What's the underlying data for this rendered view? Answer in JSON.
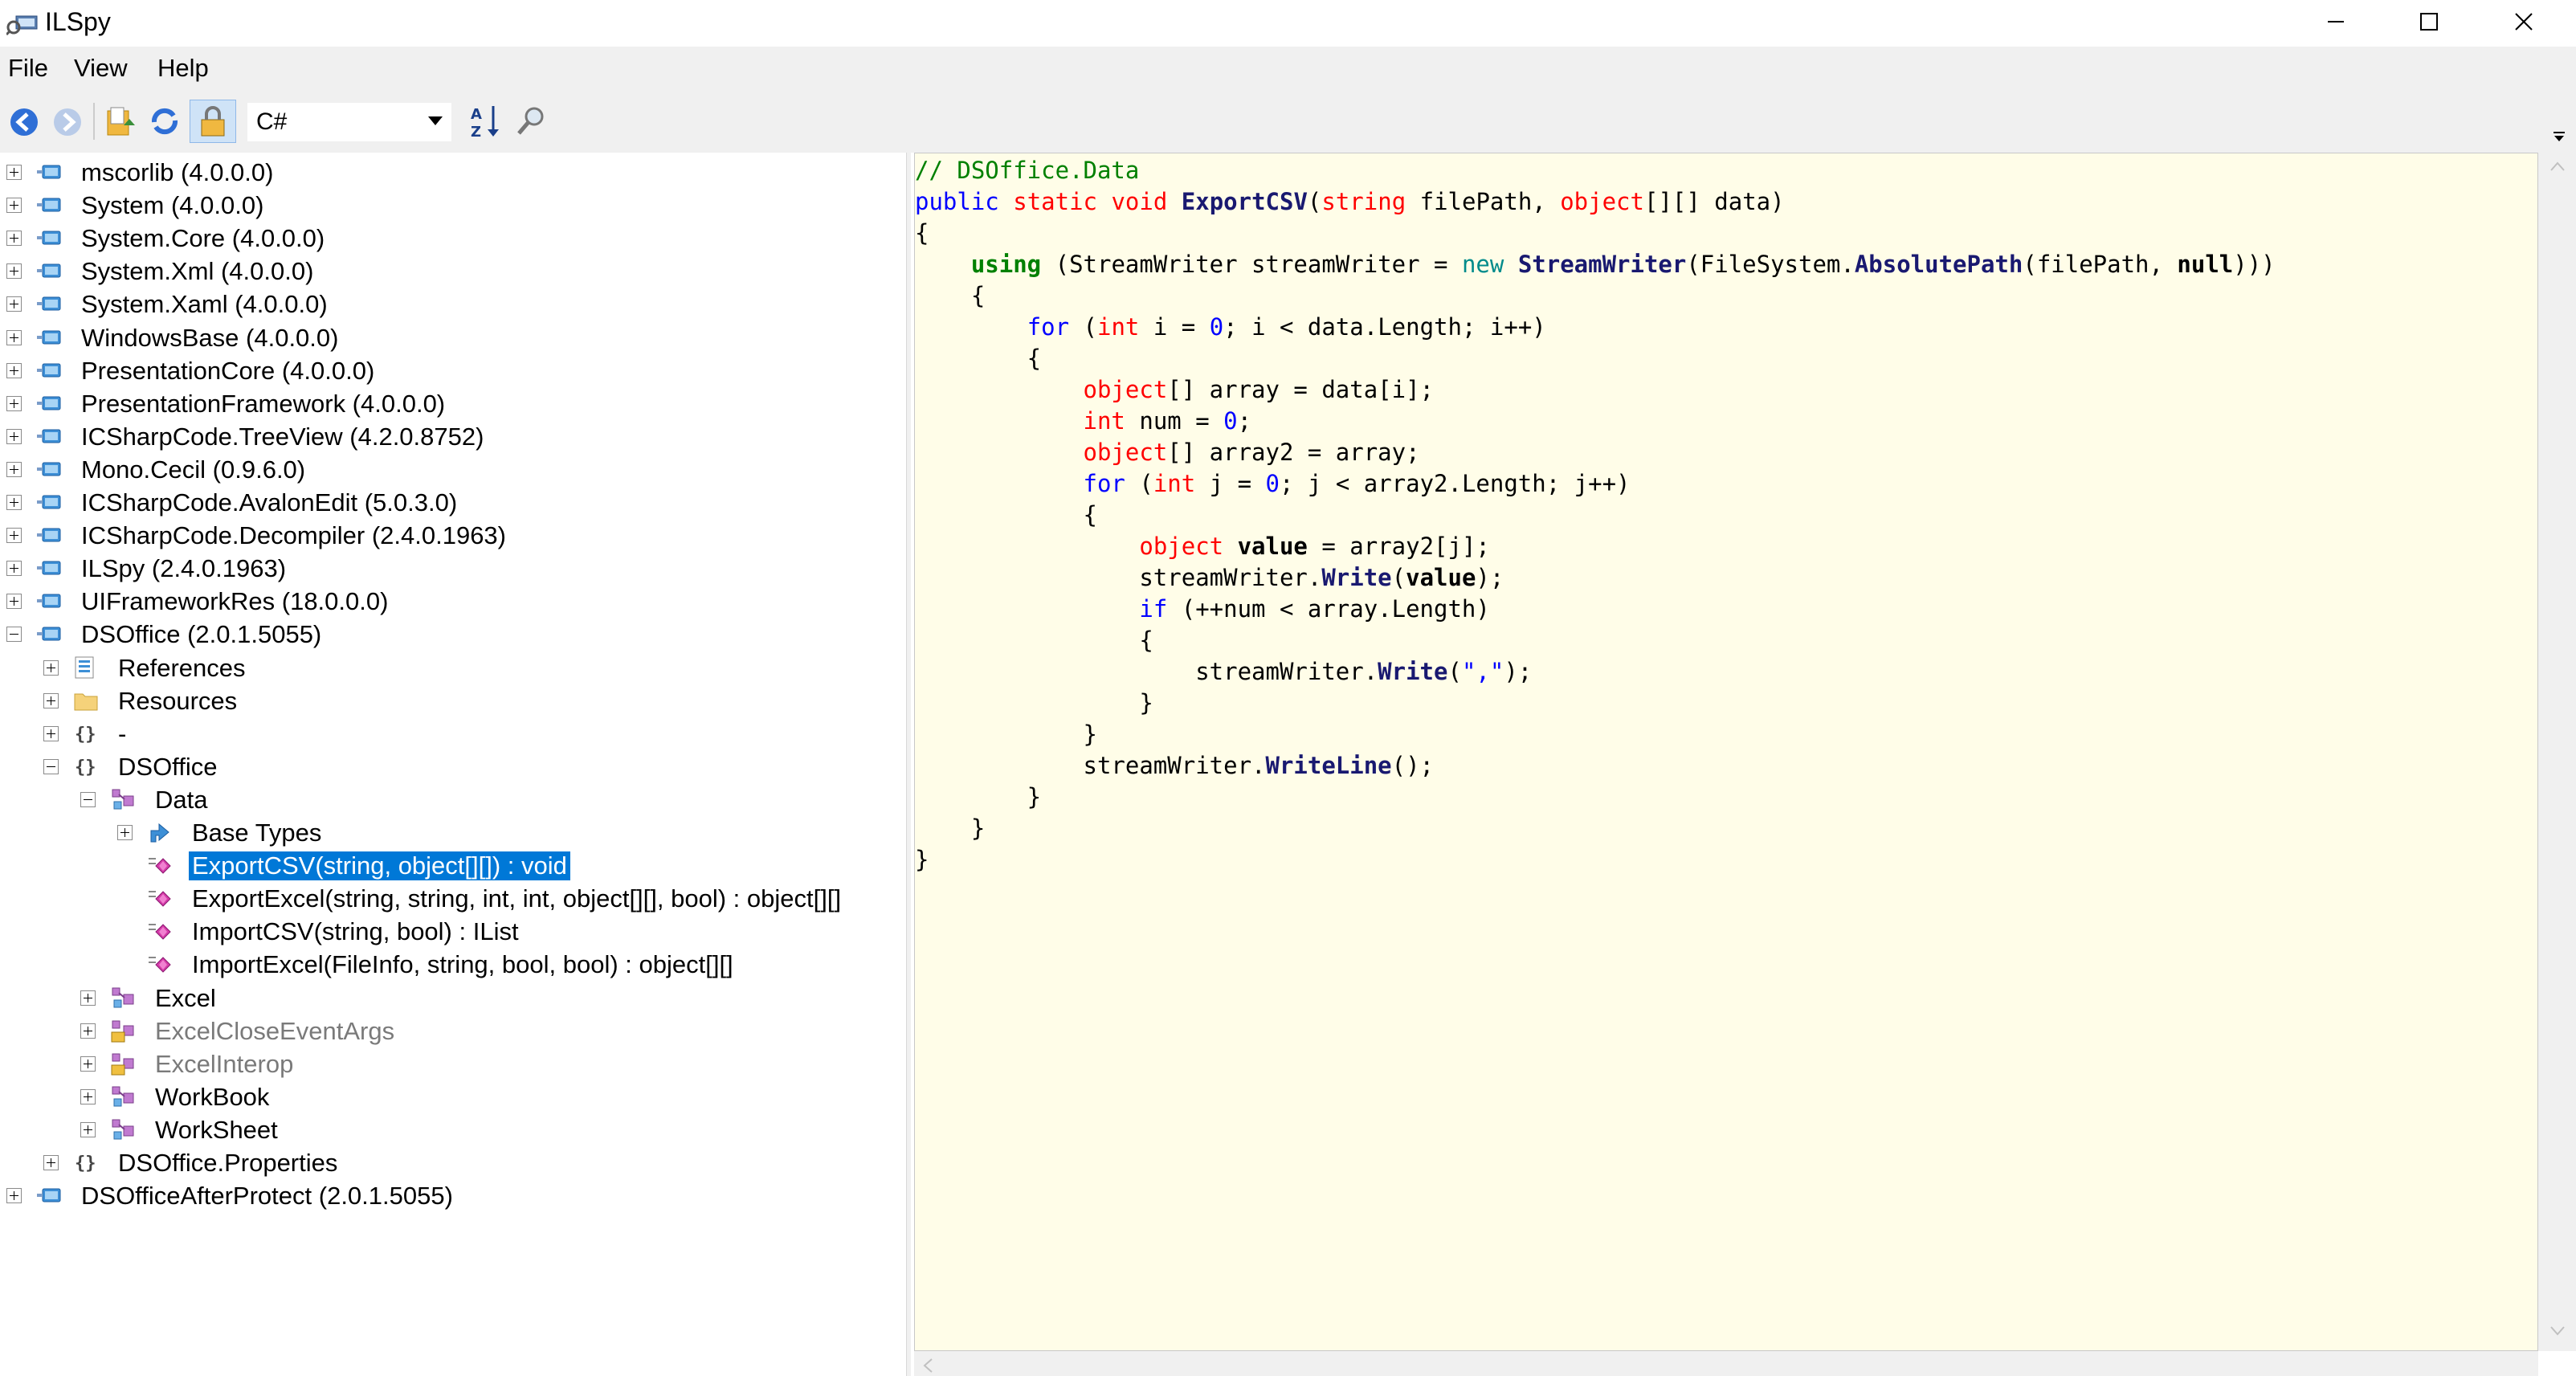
{
  "window": {
    "title": "ILSpy",
    "controls": {
      "minimize": "—",
      "maximize": "☐",
      "close": "✕"
    }
  },
  "menu": {
    "items": [
      "File",
      "View",
      "Help"
    ]
  },
  "toolbar": {
    "language": "C#",
    "icons": [
      "back-icon",
      "forward-icon",
      "open-icon",
      "reload-icon",
      "show-private-icon",
      "sort-icon",
      "search-icon"
    ]
  },
  "tree": {
    "nodes": [
      {
        "label": "mscorlib (4.0.0.0)",
        "level": 0,
        "icon": "assembly-icon",
        "expander": "plus"
      },
      {
        "label": "System (4.0.0.0)",
        "level": 0,
        "icon": "assembly-icon",
        "expander": "plus"
      },
      {
        "label": "System.Core (4.0.0.0)",
        "level": 0,
        "icon": "assembly-icon",
        "expander": "plus"
      },
      {
        "label": "System.Xml (4.0.0.0)",
        "level": 0,
        "icon": "assembly-icon",
        "expander": "plus"
      },
      {
        "label": "System.Xaml (4.0.0.0)",
        "level": 0,
        "icon": "assembly-icon",
        "expander": "plus"
      },
      {
        "label": "WindowsBase (4.0.0.0)",
        "level": 0,
        "icon": "assembly-icon",
        "expander": "plus"
      },
      {
        "label": "PresentationCore (4.0.0.0)",
        "level": 0,
        "icon": "assembly-icon",
        "expander": "plus"
      },
      {
        "label": "PresentationFramework (4.0.0.0)",
        "level": 0,
        "icon": "assembly-icon",
        "expander": "plus"
      },
      {
        "label": "ICSharpCode.TreeView (4.2.0.8752)",
        "level": 0,
        "icon": "assembly-icon",
        "expander": "plus"
      },
      {
        "label": "Mono.Cecil (0.9.6.0)",
        "level": 0,
        "icon": "assembly-icon",
        "expander": "plus"
      },
      {
        "label": "ICSharpCode.AvalonEdit (5.0.3.0)",
        "level": 0,
        "icon": "assembly-icon",
        "expander": "plus"
      },
      {
        "label": "ICSharpCode.Decompiler (2.4.0.1963)",
        "level": 0,
        "icon": "assembly-icon",
        "expander": "plus"
      },
      {
        "label": "ILSpy (2.4.0.1963)",
        "level": 0,
        "icon": "assembly-icon",
        "expander": "plus"
      },
      {
        "label": "UIFrameworkRes (18.0.0.0)",
        "level": 0,
        "icon": "assembly-icon",
        "expander": "plus"
      },
      {
        "label": "DSOffice (2.0.1.5055)",
        "level": 0,
        "icon": "assembly-icon",
        "expander": "minus"
      },
      {
        "label": "References",
        "level": 1,
        "icon": "references-icon",
        "expander": "plus"
      },
      {
        "label": "Resources",
        "level": 1,
        "icon": "folder-icon",
        "expander": "plus"
      },
      {
        "label": "-",
        "level": 1,
        "icon": "namespace-icon",
        "expander": "plus"
      },
      {
        "label": "DSOffice",
        "level": 1,
        "icon": "namespace-icon",
        "expander": "minus"
      },
      {
        "label": "Data",
        "level": 2,
        "icon": "class-icon",
        "expander": "minus"
      },
      {
        "label": "Base Types",
        "level": 3,
        "icon": "base-types-icon",
        "expander": "plus"
      },
      {
        "label": "ExportCSV(string, object[][]) : void",
        "level": 3,
        "icon": "method-icon",
        "expander": "none",
        "selected": true
      },
      {
        "label": "ExportExcel(string, string, int, int, object[][], bool) : object[][]",
        "level": 3,
        "icon": "method-icon",
        "expander": "none"
      },
      {
        "label": "ImportCSV(string, bool) : IList",
        "level": 3,
        "icon": "method-icon",
        "expander": "none"
      },
      {
        "label": "ImportExcel(FileInfo, string, bool, bool) : object[][]",
        "level": 3,
        "icon": "method-icon",
        "expander": "none"
      },
      {
        "label": "Excel",
        "level": 2,
        "icon": "class-icon",
        "expander": "plus"
      },
      {
        "label": "ExcelCloseEventArgs",
        "level": 2,
        "icon": "internal-class-icon",
        "expander": "plus",
        "gray": true
      },
      {
        "label": "ExcelInterop",
        "level": 2,
        "icon": "internal-class-icon",
        "expander": "plus",
        "gray": true
      },
      {
        "label": "WorkBook",
        "level": 2,
        "icon": "class-icon",
        "expander": "plus"
      },
      {
        "label": "WorkSheet",
        "level": 2,
        "icon": "class-icon",
        "expander": "plus"
      },
      {
        "label": "DSOffice.Properties",
        "level": 1,
        "icon": "namespace-icon",
        "expander": "plus"
      },
      {
        "label": "DSOfficeAfterProtect (2.0.1.5055)",
        "level": 0,
        "icon": "assembly-icon",
        "expander": "plus"
      }
    ]
  },
  "code": {
    "lines": [
      [
        [
          "// DSOffice.Data",
          "com"
        ]
      ],
      [
        [
          "public",
          "kw"
        ],
        [
          " ",
          ""
        ],
        [
          "static",
          "red"
        ],
        [
          " ",
          ""
        ],
        [
          "void",
          "red"
        ],
        [
          " ",
          ""
        ],
        [
          "ExportCSV",
          "meth"
        ],
        [
          "(",
          ""
        ],
        [
          "string",
          "red"
        ],
        [
          " filePath, ",
          ""
        ],
        [
          "object",
          "red"
        ],
        [
          "[][] data)",
          ""
        ]
      ],
      [
        [
          "{",
          ""
        ]
      ],
      [
        [
          "    ",
          ""
        ],
        [
          "using",
          "grn"
        ],
        [
          " (StreamWriter streamWriter = ",
          ""
        ],
        [
          "new",
          "cyn"
        ],
        [
          " ",
          ""
        ],
        [
          "StreamWriter",
          "typ"
        ],
        [
          "(FileSystem.",
          ""
        ],
        [
          "AbsolutePath",
          "meth"
        ],
        [
          "(filePath, ",
          ""
        ],
        [
          "null",
          "bold"
        ],
        [
          ")))",
          ""
        ]
      ],
      [
        [
          "    {",
          ""
        ]
      ],
      [
        [
          "        ",
          ""
        ],
        [
          "for",
          "kw"
        ],
        [
          " (",
          ""
        ],
        [
          "int",
          "red"
        ],
        [
          " i = ",
          ""
        ],
        [
          "0",
          "kw"
        ],
        [
          "; i < data.Length; i++)",
          ""
        ]
      ],
      [
        [
          "        {",
          ""
        ]
      ],
      [
        [
          "            ",
          ""
        ],
        [
          "object",
          "red"
        ],
        [
          "[] array = data[i];",
          ""
        ]
      ],
      [
        [
          "            ",
          ""
        ],
        [
          "int",
          "red"
        ],
        [
          " num = ",
          ""
        ],
        [
          "0",
          "kw"
        ],
        [
          ";",
          ""
        ]
      ],
      [
        [
          "            ",
          ""
        ],
        [
          "object",
          "red"
        ],
        [
          "[] array2 = array;",
          ""
        ]
      ],
      [
        [
          "            ",
          ""
        ],
        [
          "for",
          "kw"
        ],
        [
          " (",
          ""
        ],
        [
          "int",
          "red"
        ],
        [
          " j = ",
          ""
        ],
        [
          "0",
          "kw"
        ],
        [
          "; j < array2.Length; j++)",
          ""
        ]
      ],
      [
        [
          "            {",
          ""
        ]
      ],
      [
        [
          "                ",
          ""
        ],
        [
          "object",
          "red"
        ],
        [
          " ",
          ""
        ],
        [
          "value",
          "bold"
        ],
        [
          " = array2[j];",
          ""
        ]
      ],
      [
        [
          "                streamWriter.",
          ""
        ],
        [
          "Write",
          "meth"
        ],
        [
          "(",
          ""
        ],
        [
          "value",
          "bold"
        ],
        [
          ");",
          ""
        ]
      ],
      [
        [
          "                ",
          ""
        ],
        [
          "if",
          "kw"
        ],
        [
          " (++num < array.Length)",
          ""
        ]
      ],
      [
        [
          "                {",
          ""
        ]
      ],
      [
        [
          "                    streamWriter.",
          ""
        ],
        [
          "Write",
          "meth"
        ],
        [
          "(",
          ""
        ],
        [
          "\",\"",
          "str"
        ],
        [
          ");",
          ""
        ]
      ],
      [
        [
          "                }",
          ""
        ]
      ],
      [
        [
          "            }",
          ""
        ]
      ],
      [
        [
          "            streamWriter.",
          ""
        ],
        [
          "WriteLine",
          "meth"
        ],
        [
          "();",
          ""
        ]
      ],
      [
        [
          "        }",
          ""
        ]
      ],
      [
        [
          "    }",
          ""
        ]
      ],
      [
        [
          "}",
          ""
        ]
      ]
    ]
  },
  "colors": {
    "selection": "#0078d7",
    "code_background": "#fffde8",
    "comment": "#008000",
    "keyword": "#0000ff",
    "type_keyword": "#ff0000"
  }
}
